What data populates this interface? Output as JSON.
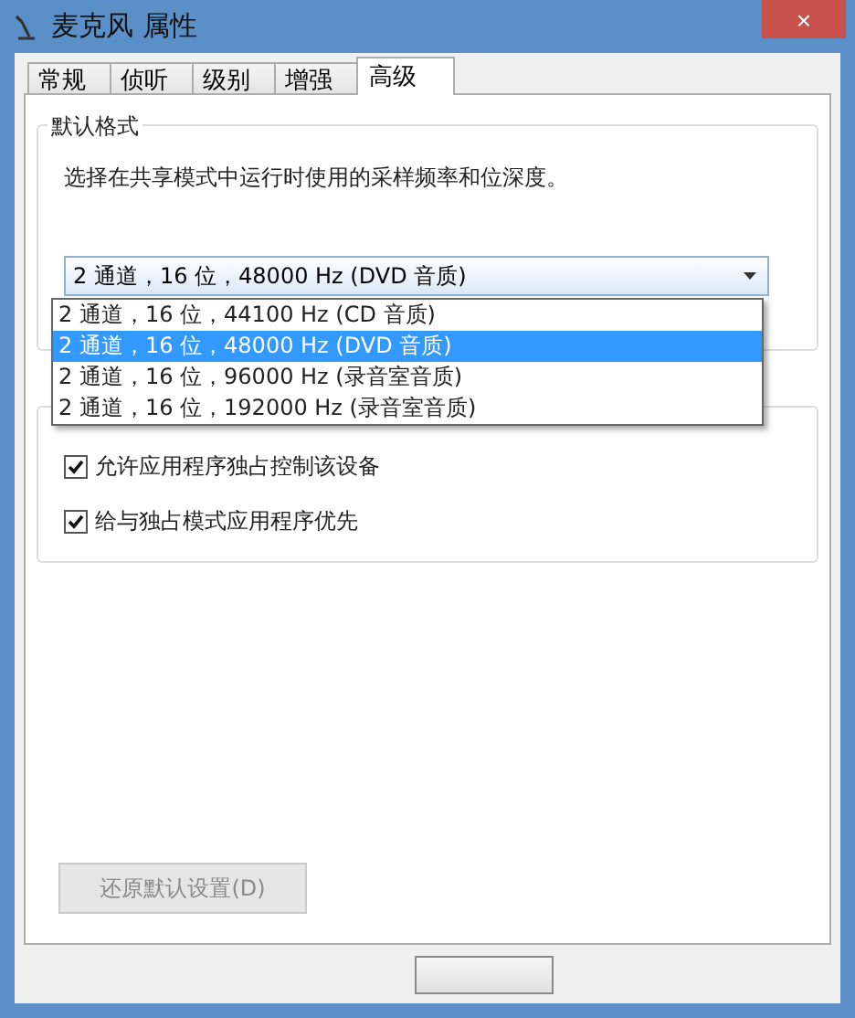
{
  "window": {
    "title": "麦克风 属性",
    "close": "×"
  },
  "tabs": [
    {
      "label": "常规",
      "selected": false
    },
    {
      "label": "侦听",
      "selected": false
    },
    {
      "label": "级别",
      "selected": false
    },
    {
      "label": "增强",
      "selected": false
    },
    {
      "label": "高级",
      "selected": true
    }
  ],
  "default_format": {
    "title": "默认格式",
    "description": "选择在共享模式中运行时使用的采样频率和位深度。",
    "dropdown": {
      "value": "2 通道，16 位，48000 Hz (DVD 音质)",
      "expanded": true,
      "options": [
        {
          "label": "2 通道，16 位，44100 Hz (CD 音质)",
          "selected": false
        },
        {
          "label": "2 通道，16 位，48000 Hz (DVD 音质)",
          "selected": true
        },
        {
          "label": "2 通道，16 位，96000 Hz (录音室音质)",
          "selected": false
        },
        {
          "label": "2 通道，16 位，192000 Hz (录音室音质)",
          "selected": false
        }
      ]
    }
  },
  "exclusive_mode": {
    "checkboxes": [
      {
        "label": "允许应用程序独占控制该设备",
        "checked": true
      },
      {
        "label": "给与独占模式应用程序优先",
        "checked": true
      }
    ]
  },
  "restore_button": {
    "label": "还原默认设置(D)",
    "disabled": true
  }
}
